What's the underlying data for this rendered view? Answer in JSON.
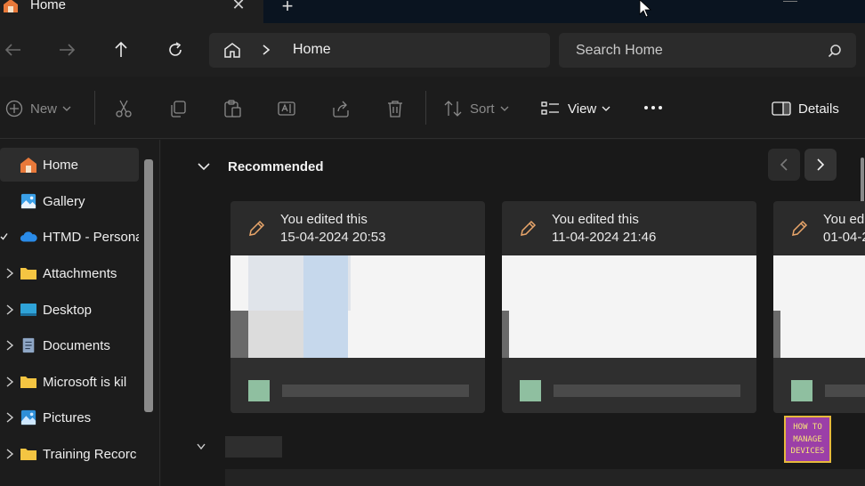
{
  "window": {
    "tab_title": "Home",
    "tab_close": "✕",
    "new_tab": "+"
  },
  "navigation": {
    "breadcrumb_separator": "›",
    "breadcrumb_location": "Home",
    "search_placeholder": "Search Home"
  },
  "command_bar": {
    "new_label": "New",
    "sort_label": "Sort",
    "view_label": "View",
    "details_label": "Details"
  },
  "sidebar": {
    "items": [
      {
        "label": "Home",
        "icon": "home-icon",
        "selected": true
      },
      {
        "label": "Gallery",
        "icon": "gallery-icon"
      },
      {
        "label": "HTMD - Persona",
        "icon": "onedrive-icon"
      },
      {
        "label": "Attachments",
        "icon": "folder-icon"
      },
      {
        "label": "Desktop",
        "icon": "desktop-icon"
      },
      {
        "label": "Documents",
        "icon": "documents-icon"
      },
      {
        "label": "Microsoft is kil",
        "icon": "folder-icon"
      },
      {
        "label": "Pictures",
        "icon": "pictures-icon"
      },
      {
        "label": "Training Recorc",
        "icon": "folder-icon"
      }
    ]
  },
  "main": {
    "section_title": "Recommended",
    "cards": [
      {
        "line1": "You edited this",
        "line2": "15-04-2024 20:53"
      },
      {
        "line1": "You edited this",
        "line2": "11-04-2024 21:46"
      },
      {
        "line1": "You edi",
        "line2": "01-04-2"
      }
    ]
  },
  "watermark": {
    "line1": "HOW TO",
    "line2": "MANAGE",
    "line3": "DEVICES"
  },
  "colors": {
    "accent_folder": "#f4c542",
    "accent_blue": "#3aa0e8",
    "watermark_bg": "#9b3fa8"
  }
}
